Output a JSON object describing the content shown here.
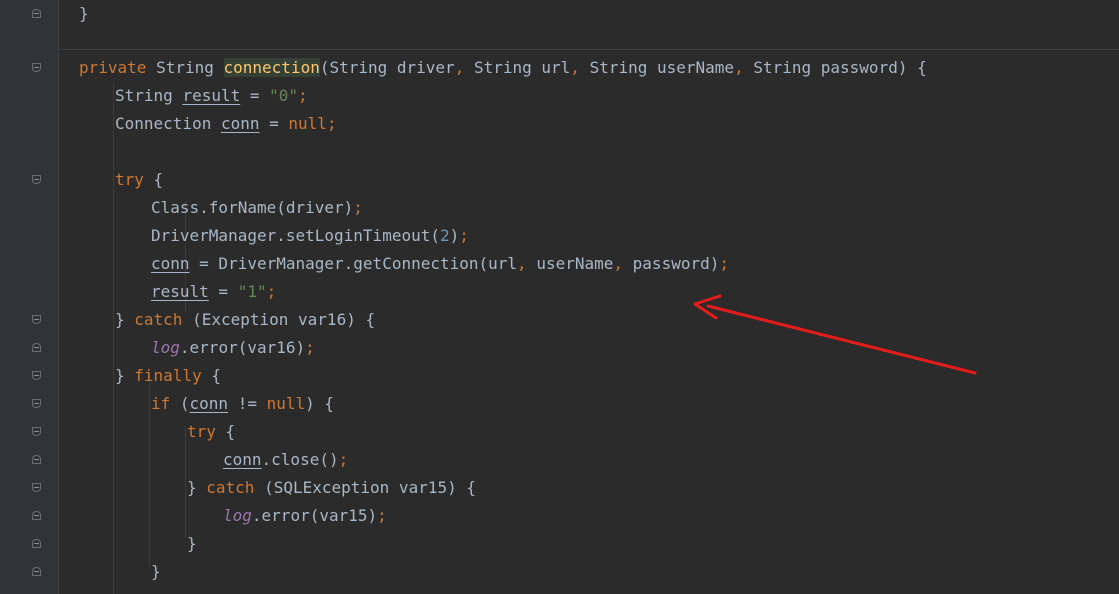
{
  "editor": {
    "language": "java",
    "theme_colors": {
      "background": "#2b2b2b",
      "gutter": "#313335",
      "keyword": "#cc7832",
      "string": "#6a8759",
      "number": "#6897bb",
      "plain": "#a9b7c6",
      "field": "#9876aa",
      "method_highlight": "#ffc66d",
      "annotation_arrow": "#e51c1c"
    },
    "lines": [
      [
        {
          "t": "}",
          "c": "plain"
        }
      ],
      [
        {
          "t": "private",
          "c": "kw"
        },
        {
          "t": " String ",
          "c": "plain"
        },
        {
          "t": "connection",
          "c": "method-hl"
        },
        {
          "t": "(String driver",
          "c": "plain"
        },
        {
          "t": ",",
          "c": "kw"
        },
        {
          "t": " String url",
          "c": "plain"
        },
        {
          "t": ",",
          "c": "kw"
        },
        {
          "t": " String userName",
          "c": "plain"
        },
        {
          "t": ",",
          "c": "kw"
        },
        {
          "t": " String password) {",
          "c": "plain"
        }
      ],
      [
        {
          "t": "String ",
          "c": "plain"
        },
        {
          "t": "result",
          "c": "var"
        },
        {
          "t": " = ",
          "c": "plain"
        },
        {
          "t": "\"0\"",
          "c": "str"
        },
        {
          "t": ";",
          "c": "kw"
        }
      ],
      [
        {
          "t": "Connection ",
          "c": "plain"
        },
        {
          "t": "conn",
          "c": "var"
        },
        {
          "t": " = ",
          "c": "plain"
        },
        {
          "t": "null",
          "c": "kw"
        },
        {
          "t": ";",
          "c": "kw"
        }
      ],
      [],
      [
        {
          "t": "try",
          "c": "kw"
        },
        {
          "t": " {",
          "c": "plain"
        }
      ],
      [
        {
          "t": "Class.forName(driver)",
          "c": "plain"
        },
        {
          "t": ";",
          "c": "kw"
        }
      ],
      [
        {
          "t": "DriverManager.setLoginTimeout(",
          "c": "plain"
        },
        {
          "t": "2",
          "c": "num"
        },
        {
          "t": ")",
          "c": "plain"
        },
        {
          "t": ";",
          "c": "kw"
        }
      ],
      [
        {
          "t": "conn",
          "c": "var"
        },
        {
          "t": " = DriverManager.getConnection(url",
          "c": "plain"
        },
        {
          "t": ",",
          "c": "kw"
        },
        {
          "t": " userName",
          "c": "plain"
        },
        {
          "t": ",",
          "c": "kw"
        },
        {
          "t": " password)",
          "c": "plain"
        },
        {
          "t": ";",
          "c": "kw"
        }
      ],
      [
        {
          "t": "result",
          "c": "var"
        },
        {
          "t": " = ",
          "c": "plain"
        },
        {
          "t": "\"1\"",
          "c": "str"
        },
        {
          "t": ";",
          "c": "kw"
        }
      ],
      [
        {
          "t": "} ",
          "c": "plain"
        },
        {
          "t": "catch",
          "c": "kw"
        },
        {
          "t": " (Exception var16) {",
          "c": "plain"
        }
      ],
      [
        {
          "t": "log",
          "c": "field"
        },
        {
          "t": ".error(var16)",
          "c": "plain"
        },
        {
          "t": ";",
          "c": "kw"
        }
      ],
      [
        {
          "t": "} ",
          "c": "plain"
        },
        {
          "t": "finally",
          "c": "kw"
        },
        {
          "t": " {",
          "c": "plain"
        }
      ],
      [
        {
          "t": "if",
          "c": "kw"
        },
        {
          "t": " (",
          "c": "plain"
        },
        {
          "t": "conn",
          "c": "var"
        },
        {
          "t": " != ",
          "c": "plain"
        },
        {
          "t": "null",
          "c": "kw"
        },
        {
          "t": ") {",
          "c": "plain"
        }
      ],
      [
        {
          "t": "try",
          "c": "kw"
        },
        {
          "t": " {",
          "c": "plain"
        }
      ],
      [
        {
          "t": "conn",
          "c": "var"
        },
        {
          "t": ".close()",
          "c": "plain"
        },
        {
          "t": ";",
          "c": "kw"
        }
      ],
      [
        {
          "t": "} ",
          "c": "plain"
        },
        {
          "t": "catch",
          "c": "kw"
        },
        {
          "t": " (SQLException var15) {",
          "c": "plain"
        }
      ],
      [
        {
          "t": "log",
          "c": "field"
        },
        {
          "t": ".error(var15)",
          "c": "plain"
        },
        {
          "t": ";",
          "c": "kw"
        }
      ],
      [
        {
          "t": "}",
          "c": "plain"
        }
      ],
      [
        {
          "t": "}",
          "c": "plain"
        }
      ]
    ]
  }
}
